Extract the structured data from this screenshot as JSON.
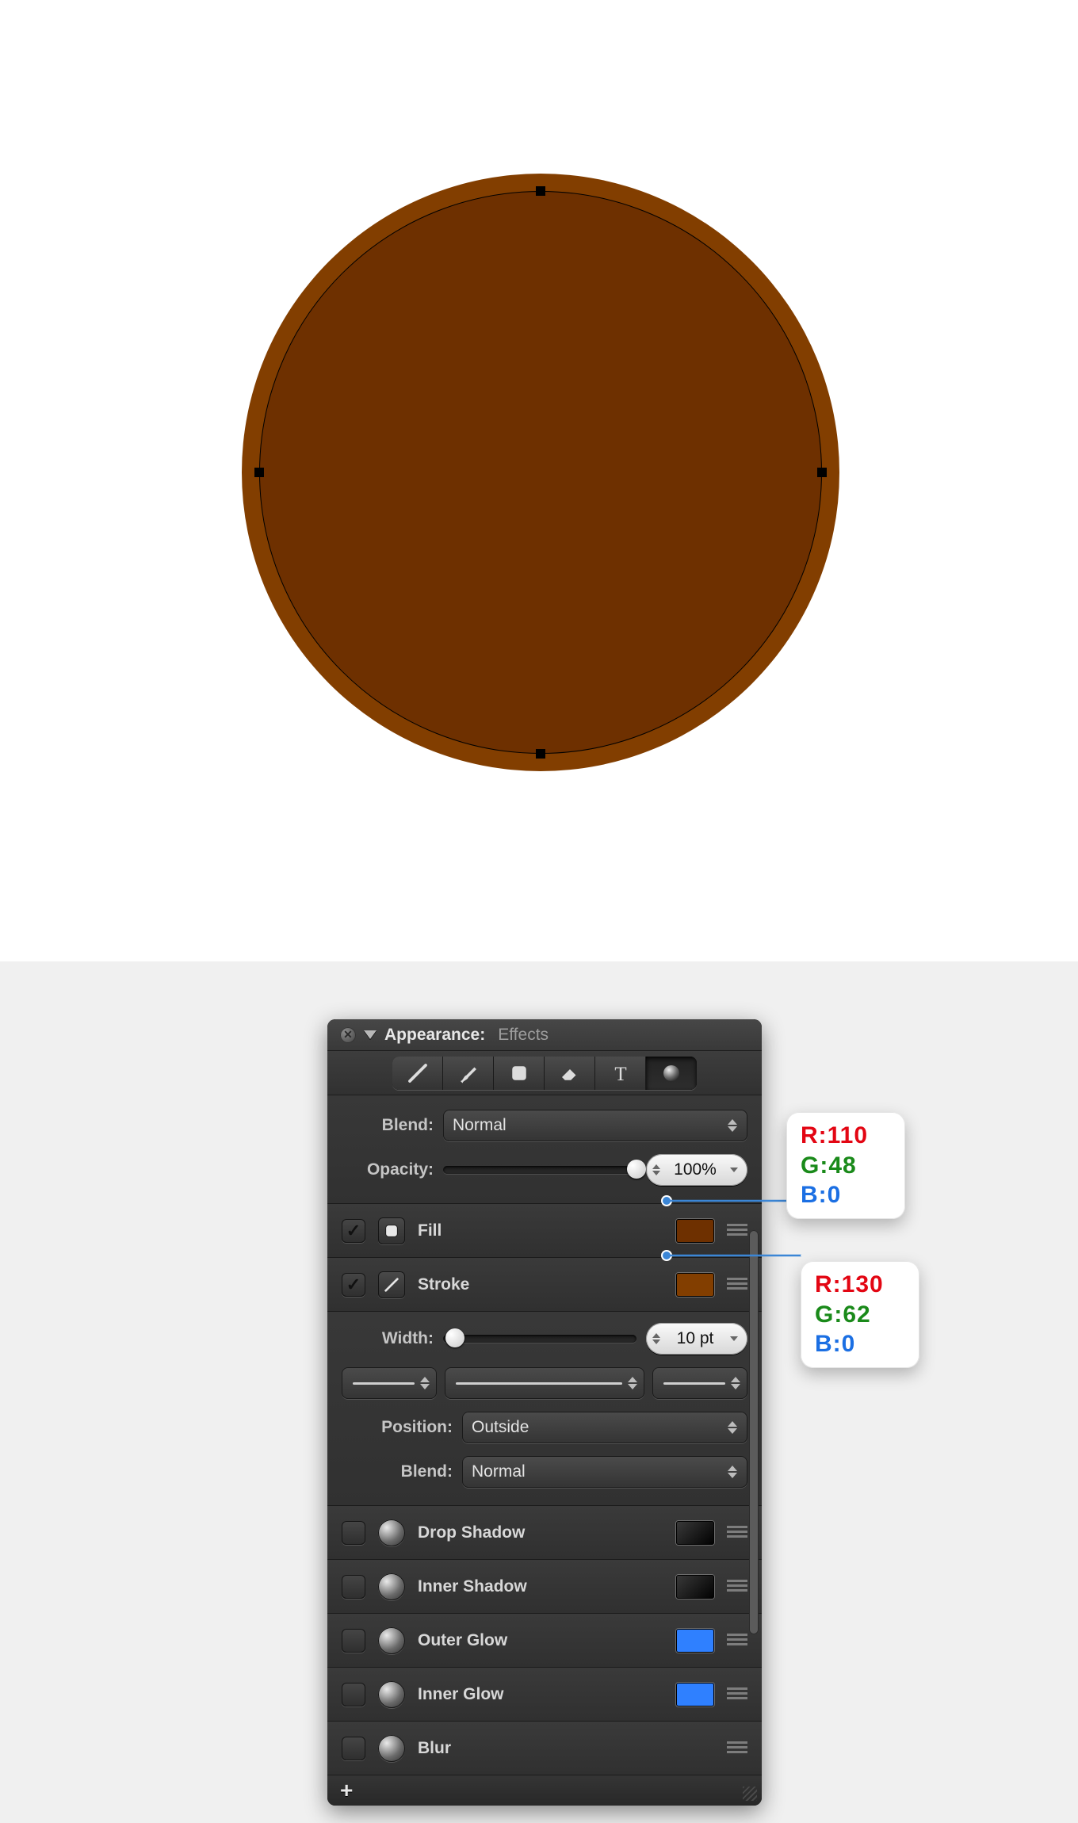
{
  "canvas": {
    "fill_color": "#6e3000",
    "stroke_color": "#823e00",
    "selection_handles": true
  },
  "panel": {
    "title": "Appearance:",
    "subtitle": "Effects",
    "tabs": {
      "path": "path-tool-icon",
      "brush": "brush-tool-icon",
      "rect": "rect-tool-icon",
      "erase": "eraser-tool-icon",
      "text": "text-tool-icon",
      "fx": "fx-tool-icon"
    },
    "blend_label": "Blend:",
    "blend_value": "Normal",
    "opacity_label": "Opacity:",
    "opacity_value": "100%",
    "opacity_pct": 100,
    "fill": {
      "label": "Fill",
      "checked": true,
      "swatch": "#6e3000"
    },
    "stroke": {
      "label": "Stroke",
      "checked": true,
      "swatch": "#823e00"
    },
    "width_label": "Width:",
    "width_value": "10 pt",
    "width_pct": 6,
    "position_label": "Position:",
    "position_value": "Outside",
    "stroke_blend_label": "Blend:",
    "stroke_blend_value": "Normal",
    "effects": [
      {
        "label": "Drop Shadow",
        "swatch": "#000000",
        "checked": false
      },
      {
        "label": "Inner Shadow",
        "swatch": "#000000",
        "checked": false
      },
      {
        "label": "Outer Glow",
        "swatch": "#2f80ff",
        "checked": false
      },
      {
        "label": "Inner Glow",
        "swatch": "#2f80ff",
        "checked": false
      },
      {
        "label": "Blur",
        "swatch": null,
        "checked": false
      }
    ],
    "footer_plus": "+"
  },
  "callouts": {
    "fill": {
      "r": "R:110",
      "g": "G:48",
      "b": "B:0"
    },
    "stroke": {
      "r": "R:130",
      "g": "G:62",
      "b": "B:0"
    }
  }
}
